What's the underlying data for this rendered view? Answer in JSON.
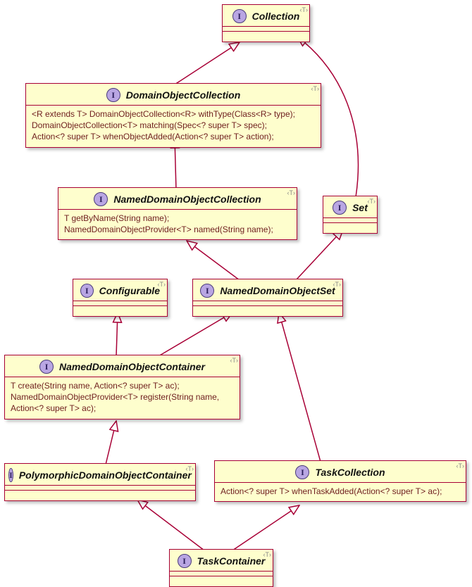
{
  "chart_data": {
    "type": "uml-class-diagram",
    "nodes": [
      {
        "id": "Collection",
        "stereotype": "interface",
        "name": "Collection",
        "members": []
      },
      {
        "id": "DomainObjectCollection",
        "stereotype": "interface",
        "name": "DomainObjectCollection",
        "members": [
          "<R extends T> DomainObjectCollection<R> withType(Class<R> type);",
          "DomainObjectCollection<T> matching(Spec<? super T> spec);",
          "Action<? super T> whenObjectAdded(Action<? super T> action);"
        ]
      },
      {
        "id": "NamedDomainObjectCollection",
        "stereotype": "interface",
        "name": "NamedDomainObjectCollection",
        "members": [
          "T getByName(String name);",
          "NamedDomainObjectProvider<T> named(String name);"
        ]
      },
      {
        "id": "Set",
        "stereotype": "interface",
        "name": "Set",
        "members": []
      },
      {
        "id": "Configurable",
        "stereotype": "interface",
        "name": "Configurable",
        "members": []
      },
      {
        "id": "NamedDomainObjectSet",
        "stereotype": "interface",
        "name": "NamedDomainObjectSet",
        "members": []
      },
      {
        "id": "NamedDomainObjectContainer",
        "stereotype": "interface",
        "name": "NamedDomainObjectContainer",
        "members": [
          "T create(String name, Action<? super T> ac);",
          "NamedDomainObjectProvider<T> register(String name,",
          "Action<? super T> ac);"
        ]
      },
      {
        "id": "PolymorphicDomainObjectContainer",
        "stereotype": "interface",
        "name": "PolymorphicDomainObjectContainer",
        "members": []
      },
      {
        "id": "TaskCollection",
        "stereotype": "interface",
        "name": "TaskCollection",
        "members": [
          "Action<? super T> whenTaskAdded(Action<? super T> ac);"
        ]
      },
      {
        "id": "TaskContainer",
        "stereotype": "interface",
        "name": "TaskContainer",
        "members": []
      }
    ],
    "edges": [
      {
        "from": "DomainObjectCollection",
        "to": "Collection",
        "type": "generalization"
      },
      {
        "from": "Set",
        "to": "Collection",
        "type": "generalization"
      },
      {
        "from": "NamedDomainObjectCollection",
        "to": "DomainObjectCollection",
        "type": "generalization"
      },
      {
        "from": "NamedDomainObjectSet",
        "to": "NamedDomainObjectCollection",
        "type": "generalization"
      },
      {
        "from": "NamedDomainObjectSet",
        "to": "Set",
        "type": "generalization"
      },
      {
        "from": "NamedDomainObjectContainer",
        "to": "Configurable",
        "type": "generalization"
      },
      {
        "from": "NamedDomainObjectContainer",
        "to": "NamedDomainObjectSet",
        "type": "generalization"
      },
      {
        "from": "PolymorphicDomainObjectContainer",
        "to": "NamedDomainObjectContainer",
        "type": "generalization"
      },
      {
        "from": "TaskCollection",
        "to": "NamedDomainObjectSet",
        "type": "generalization"
      },
      {
        "from": "TaskContainer",
        "to": "PolymorphicDomainObjectContainer",
        "type": "generalization"
      },
      {
        "from": "TaskContainer",
        "to": "TaskCollection",
        "type": "generalization"
      }
    ]
  },
  "nodes": {
    "collection": {
      "name": "Collection"
    },
    "doc": {
      "name": "DomainObjectCollection",
      "m0": "<R extends T> DomainObjectCollection<R> withType(Class<R> type);",
      "m1": "DomainObjectCollection<T> matching(Spec<? super T> spec);",
      "m2": "Action<? super T> whenObjectAdded(Action<? super T> action);"
    },
    "ndoc": {
      "name": "NamedDomainObjectCollection",
      "m0": "T getByName(String name);",
      "m1": "NamedDomainObjectProvider<T> named(String name);"
    },
    "set": {
      "name": "Set"
    },
    "configurable": {
      "name": "Configurable"
    },
    "ndos": {
      "name": "NamedDomainObjectSet"
    },
    "ndocont": {
      "name": "NamedDomainObjectContainer",
      "m0": "T create(String name, Action<? super T> ac);",
      "m1": "NamedDomainObjectProvider<T> register(String name,",
      "m2": "Action<? super T> ac);"
    },
    "poly": {
      "name": "PolymorphicDomainObjectContainer"
    },
    "taskcoll": {
      "name": "TaskCollection",
      "m0": "Action<? super T> whenTaskAdded(Action<? super T> ac);"
    },
    "taskcont": {
      "name": "TaskContainer"
    }
  },
  "glyph": {
    "interface": "I",
    "corner": "‹T›"
  }
}
